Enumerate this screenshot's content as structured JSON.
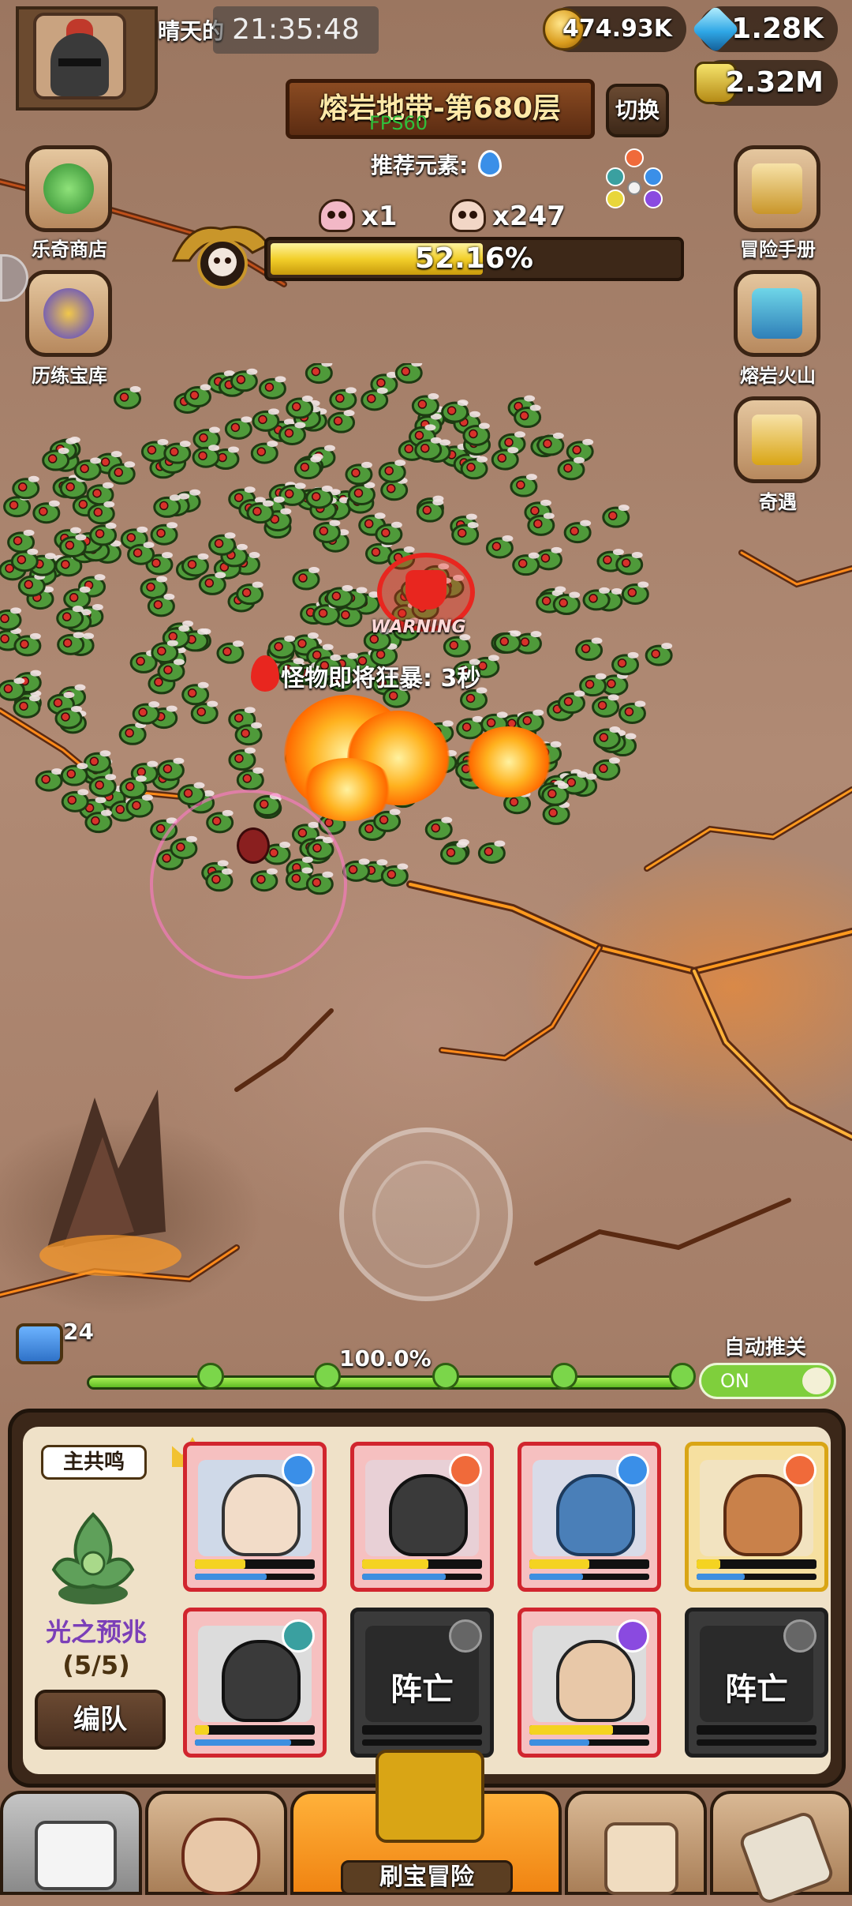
{
  "top": {
    "player_name": "晴天的",
    "clock": "21:35:48",
    "gold": "474.93K",
    "gems": "1.28K",
    "potion": "2.32M"
  },
  "stage": {
    "title": "熔岩地带-第680层",
    "switch_label": "切换",
    "fps": "FPS60",
    "recommended_label": "推荐元素:",
    "boss_kills": "x1",
    "monster_kills": "x247",
    "progress_label": "52.16%",
    "progress_value": 52.16
  },
  "side_left": [
    {
      "label": "乐奇商店"
    },
    {
      "label": "历练宝库"
    }
  ],
  "side_right": [
    {
      "label": "冒险手册"
    },
    {
      "label": "熔岩火山"
    },
    {
      "label": "奇遇"
    }
  ],
  "battle": {
    "warning": "WARNING",
    "rage_text": "怪物即将狂暴: 3秒"
  },
  "wave": {
    "chest_count": "24",
    "percent_label": "100.0%",
    "percent_value": 100,
    "auto_label": "自动推关",
    "toggle_label": "ON"
  },
  "team": {
    "leader_tag": "主共鸣",
    "formation_name": "光之预兆",
    "formation_count": "(5/5)",
    "formation_button": "编队",
    "dead_label_1": "阵亡",
    "dead_label_2": "阵亡"
  },
  "nav": {
    "main_label": "刷宝冒险"
  },
  "colors": {
    "accent_gold": "#f2cf2a",
    "card_red": "#d1252e",
    "card_gold": "#d9a515",
    "formation_purple": "#7b3fb8",
    "toggle_green": "#7fcf3c"
  }
}
